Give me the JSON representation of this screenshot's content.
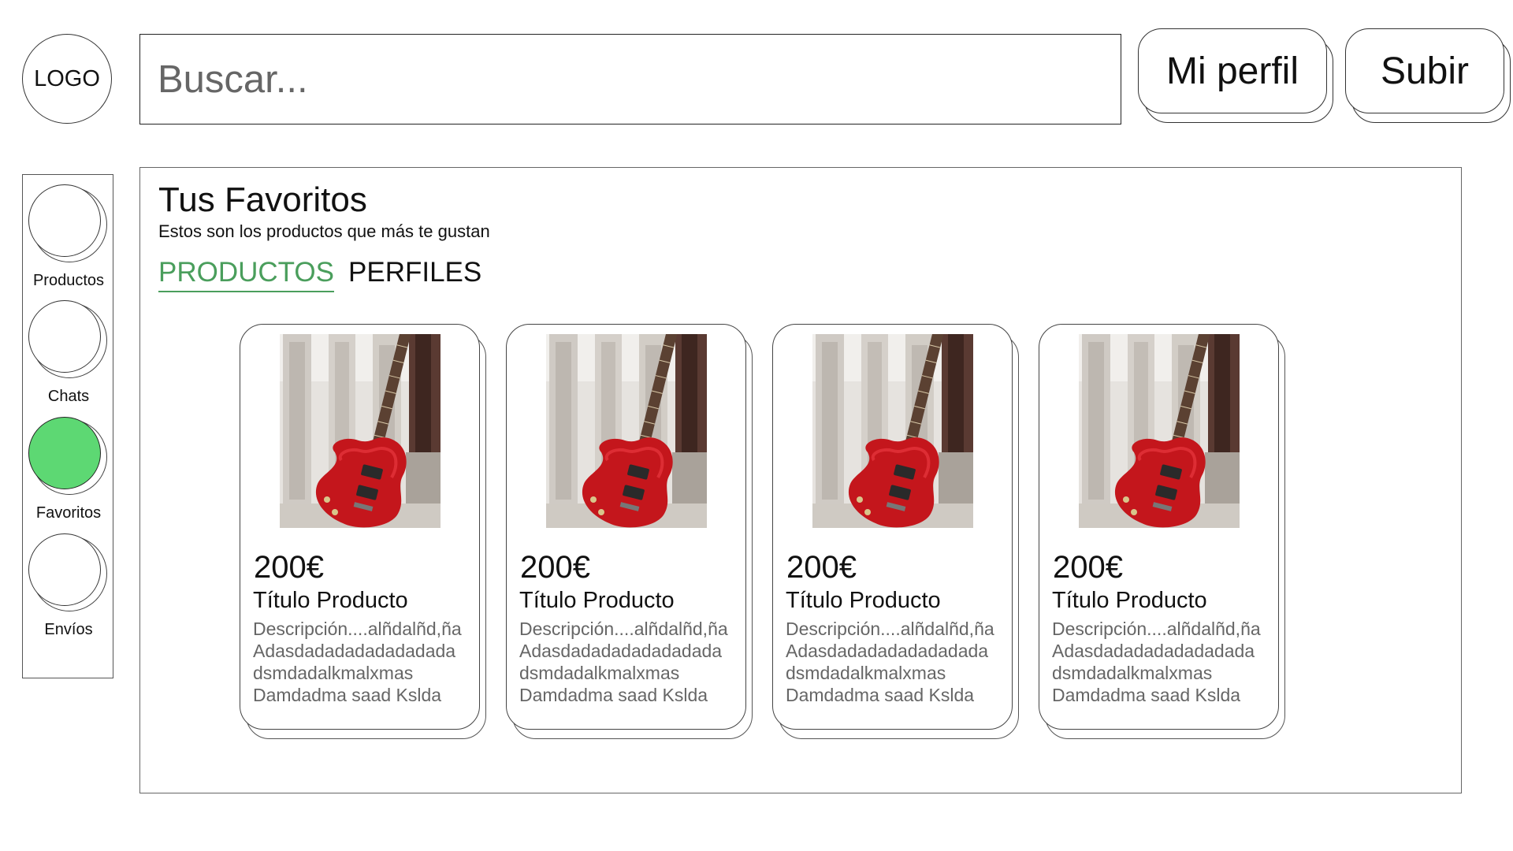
{
  "header": {
    "logo_text": "LOGO",
    "search_placeholder": "Buscar...",
    "profile_button": "Mi perfil",
    "upload_button": "Subir"
  },
  "sidebar": {
    "items": [
      {
        "label": "Productos",
        "active": false
      },
      {
        "label": "Chats",
        "active": false
      },
      {
        "label": "Favoritos",
        "active": true
      },
      {
        "label": "Envíos",
        "active": false
      }
    ],
    "active_color": "#5dd873"
  },
  "main": {
    "title": "Tus Favoritos",
    "subtitle": "Estos son los productos que más te gustan",
    "tabs": [
      {
        "label": "PRODUCTOS",
        "active": true
      },
      {
        "label": "PERFILES",
        "active": false
      }
    ],
    "active_tab_color": "#4a9e5c"
  },
  "products": [
    {
      "image": "red-electric-guitar-photo",
      "price": "200€",
      "title": "Título Producto",
      "description": [
        "Descripción....alñdalñd,ña",
        "Adasdadadadadadadada",
        "dsmdadalkmalxmas",
        "Damdadma saad Kslda"
      ]
    },
    {
      "image": "red-electric-guitar-photo",
      "price": "200€",
      "title": "Título Producto",
      "description": [
        "Descripción....alñdalñd,ña",
        "Adasdadadadadadadada",
        "dsmdadalkmalxmas",
        "Damdadma saad Kslda"
      ]
    },
    {
      "image": "red-electric-guitar-photo",
      "price": "200€",
      "title": "Título Producto",
      "description": [
        "Descripción....alñdalñd,ña",
        "Adasdadadadadadadada",
        "dsmdadalkmalxmas",
        "Damdadma saad Kslda"
      ]
    },
    {
      "image": "red-electric-guitar-photo",
      "price": "200€",
      "title": "Título Producto",
      "description": [
        "Descripción....alñdalñd,ña",
        "Adasdadadadadadadada",
        "dsmdadalkmalxmas",
        "Damdadma saad Kslda"
      ]
    }
  ]
}
